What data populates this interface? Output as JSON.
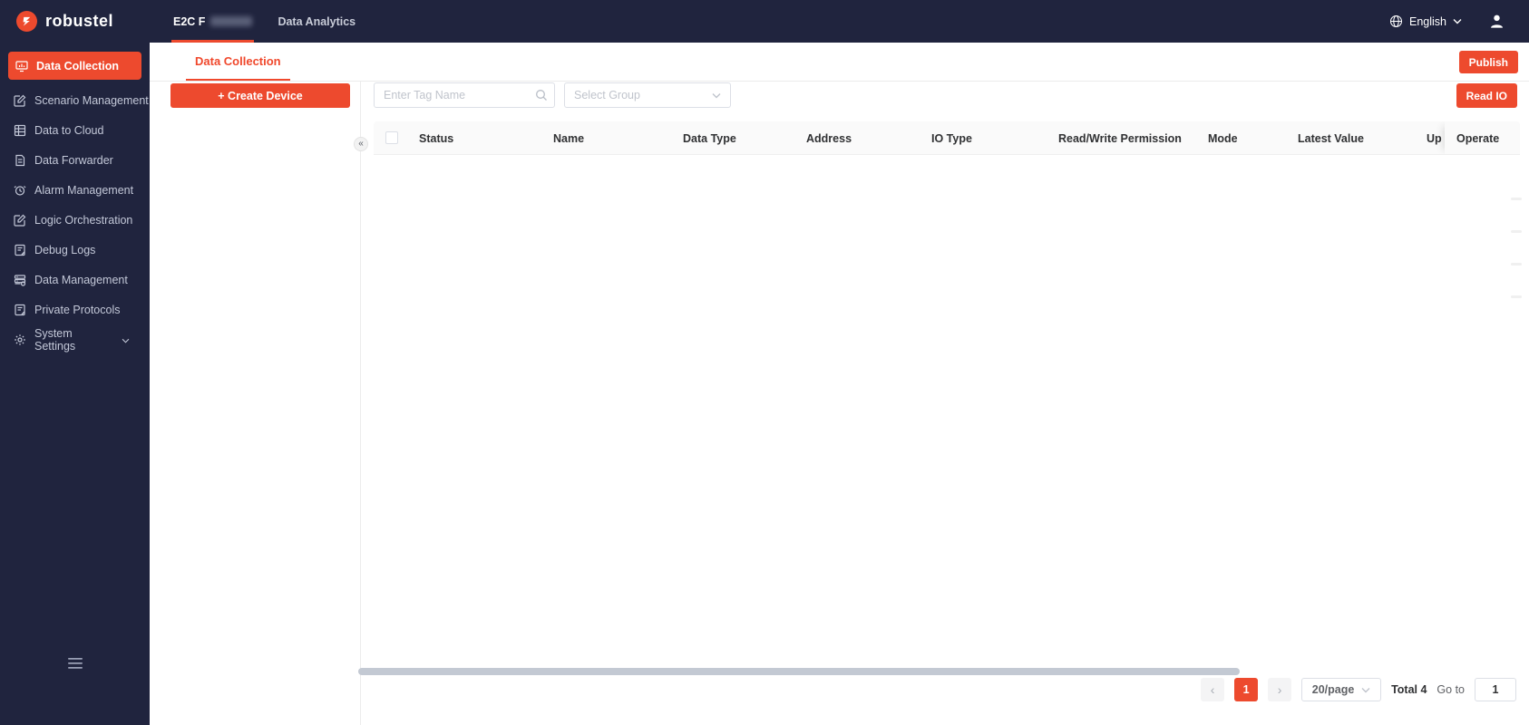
{
  "brand": {
    "name": "robustel"
  },
  "topbar": {
    "nav": [
      {
        "label_visible": "E2C F",
        "redacted": true,
        "active": true
      },
      {
        "label": "Data Analytics",
        "active": false
      }
    ],
    "language": {
      "label": "English"
    }
  },
  "sidebar": {
    "items": [
      {
        "label": "Data Collection",
        "icon": "monitor-icon",
        "active": true
      },
      {
        "label": "Scenario Management",
        "icon": "edit-square-icon",
        "active": false
      },
      {
        "label": "Data to Cloud",
        "icon": "table-icon",
        "active": false
      },
      {
        "label": "Data Forwarder",
        "icon": "document-icon",
        "active": false
      },
      {
        "label": "Alarm Management",
        "icon": "alarm-icon",
        "active": false
      },
      {
        "label": "Logic Orchestration",
        "icon": "edit-square-icon",
        "active": false
      },
      {
        "label": "Debug Logs",
        "icon": "notebook-icon",
        "active": false
      },
      {
        "label": "Data Management",
        "icon": "database-icon",
        "active": false
      },
      {
        "label": "Private Protocols",
        "icon": "notebook-icon",
        "active": false
      },
      {
        "label": "System Settings",
        "icon": "gear-icon",
        "active": false,
        "expandable": true
      }
    ]
  },
  "page": {
    "tab": "Data Collection",
    "publish_button": "Publish",
    "create_device_button": "+ Create Device",
    "search_placeholder": "Enter Tag Name",
    "group_placeholder": "Select Group",
    "read_io_button": "Read IO",
    "collapse_glyph": "«"
  },
  "table": {
    "columns": [
      "Status",
      "Name",
      "Data Type",
      "Address",
      "IO Type",
      "Read/Write Permission",
      "Mode",
      "Latest Value",
      "Up",
      "Operate"
    ],
    "rows": []
  },
  "pagination": {
    "prev_glyph": "‹",
    "current_page": "1",
    "next_glyph": "›",
    "page_size": "20/page",
    "total_label": "Total 4",
    "goto_label": "Go to",
    "goto_value": "1"
  },
  "colors": {
    "accent": "#ed4a2e",
    "topbar_bg": "#20243e",
    "sidebar_bg": "#20243e",
    "table_header_bg": "#fafafa",
    "scrollbar_thumb": "#c3c9d3"
  }
}
